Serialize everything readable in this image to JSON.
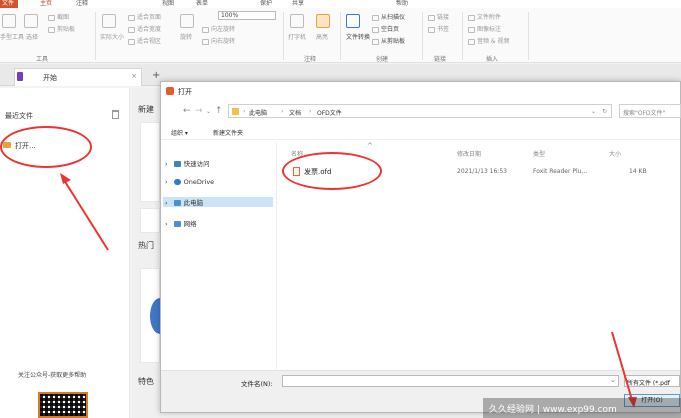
{
  "ribbon": {
    "tabs": [
      "文件",
      "主页",
      "注释",
      "视图",
      "表单",
      "保护",
      "共享",
      "帮助"
    ],
    "zoom_value": "100%",
    "groups": {
      "tools_label": "工具",
      "annotation_label": "注释",
      "create_label": "创建",
      "link_label": "链接",
      "insert_label": "插入"
    },
    "buttons": {
      "hand_tool": "手型工具",
      "select": "选择",
      "screenshot": "截图",
      "clipboard": "剪贴板",
      "actual_size": "实际大小",
      "fit_page": "适合页面",
      "fit_width": "适合宽度",
      "fit_visible": "适合视区",
      "rotate": "旋转",
      "left_rotate": "向左旋转",
      "right_rotate": "向右旋转",
      "typewriter": "打字机",
      "highlight": "高亮",
      "file_convert": "文件转换",
      "from_scanner": "从扫描仪",
      "blank_page": "空白页",
      "from_clipboard": "从剪贴板",
      "link": "链接",
      "bookmark": "书签",
      "file_attach": "文件附件",
      "image_mark": "图像标注",
      "audio_video": "音频 & 视频"
    }
  },
  "doc_tab": {
    "label": "开始"
  },
  "start_page": {
    "recent_title": "最近文件",
    "open_label": "打开...",
    "follow_text": "关注公众号-获取更多帮助",
    "mid_labels": [
      "新建",
      "热门",
      "特色"
    ]
  },
  "dialog": {
    "title": "打开",
    "breadcrumbs": [
      "此电脑",
      "文档",
      "OFD文件"
    ],
    "search_placeholder": "搜索\"OFD文件\"",
    "organize": "组织 ▾",
    "new_folder": "新建文件夹",
    "nav_items": [
      {
        "label": "快速访问",
        "color": "#3d7fd1"
      },
      {
        "label": "OneDrive",
        "color": "#2f7ad1"
      },
      {
        "label": "此电脑",
        "color": "#4a90d9"
      },
      {
        "label": "网络",
        "color": "#4a90d9"
      }
    ],
    "columns": {
      "name": "名称",
      "modified": "修改日期",
      "type": "类型",
      "size": "大小"
    },
    "file": {
      "name": "发票.ofd",
      "modified": "2021/1/13 16:53",
      "type": "Foxit Reader Plu...",
      "size": "14 KB"
    },
    "filename_label": "文件名(N):",
    "filetype": "所有文件 (*.pdf",
    "open_button": "打开(O)"
  },
  "watermark": "久久经验网 | www.exp99.com",
  "colors": {
    "accent": "#d2532e",
    "annotation": "#ee3333",
    "selection": "#cce4f7"
  }
}
